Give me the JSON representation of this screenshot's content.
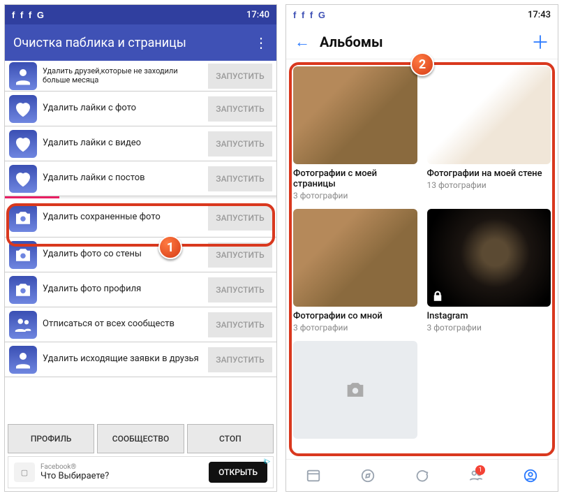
{
  "left": {
    "status": {
      "icons": "f  f  f  G",
      "time": "17:40"
    },
    "header": {
      "title": "Очистка паблика и страницы"
    },
    "rows": [
      {
        "label": "Удалить друзей,которые не заходили больше месяца",
        "btn": "ЗАПУСТИТЬ",
        "icon": "person"
      },
      {
        "label": "Удалить лайки с фото",
        "btn": "ЗАПУСТИТЬ",
        "icon": "heart"
      },
      {
        "label": "Удалить лайки с видео",
        "btn": "ЗАПУСТИТЬ",
        "icon": "heart"
      },
      {
        "label": "Удалить лайки с постов",
        "btn": "ЗАПУСТИТЬ",
        "icon": "heart"
      },
      {
        "label": "Удалить сохраненные фото",
        "btn": "ЗАПУСТИТЬ",
        "icon": "camera"
      },
      {
        "label": "Удалить фото со стены",
        "btn": "ЗАПУСТИТЬ",
        "icon": "camera"
      },
      {
        "label": "Удалить фото профиля",
        "btn": "ЗАПУСТИТЬ",
        "icon": "camera"
      },
      {
        "label": "Отписаться от всех сообществ",
        "btn": "ЗАПУСТИТЬ",
        "icon": "people"
      },
      {
        "label": "Удалить исходящие заявки в друзья",
        "btn": "ЗАПУСТИТЬ",
        "icon": "person"
      }
    ],
    "bottom": {
      "profile": "ПРОФИЛЬ",
      "community": "СООБЩЕСТВО",
      "stop": "СТОП"
    },
    "ad": {
      "brand": "Facebook®",
      "line": "Что Выбираете?",
      "cta": "ОТКРЫТЬ",
      "choice": "i▷"
    }
  },
  "right": {
    "status": {
      "icons": "f  f  f  G",
      "time": "17:43"
    },
    "header": {
      "title": "Альбомы"
    },
    "albums": [
      {
        "name": "Фотографии с моей страницы",
        "count": "3 фотографии",
        "thumb": "dog"
      },
      {
        "name": "Фотографии на моей стене",
        "count": "13 фотографии",
        "thumb": "fox"
      },
      {
        "name": "Фотографии со мной",
        "count": "3 фотографии",
        "thumb": "dog"
      },
      {
        "name": "Instagram",
        "count": "3 фотографии",
        "thumb": "galaxy",
        "locked": true
      }
    ],
    "nav_badge": "1"
  },
  "annotations": {
    "b1": "1",
    "b2": "2"
  }
}
